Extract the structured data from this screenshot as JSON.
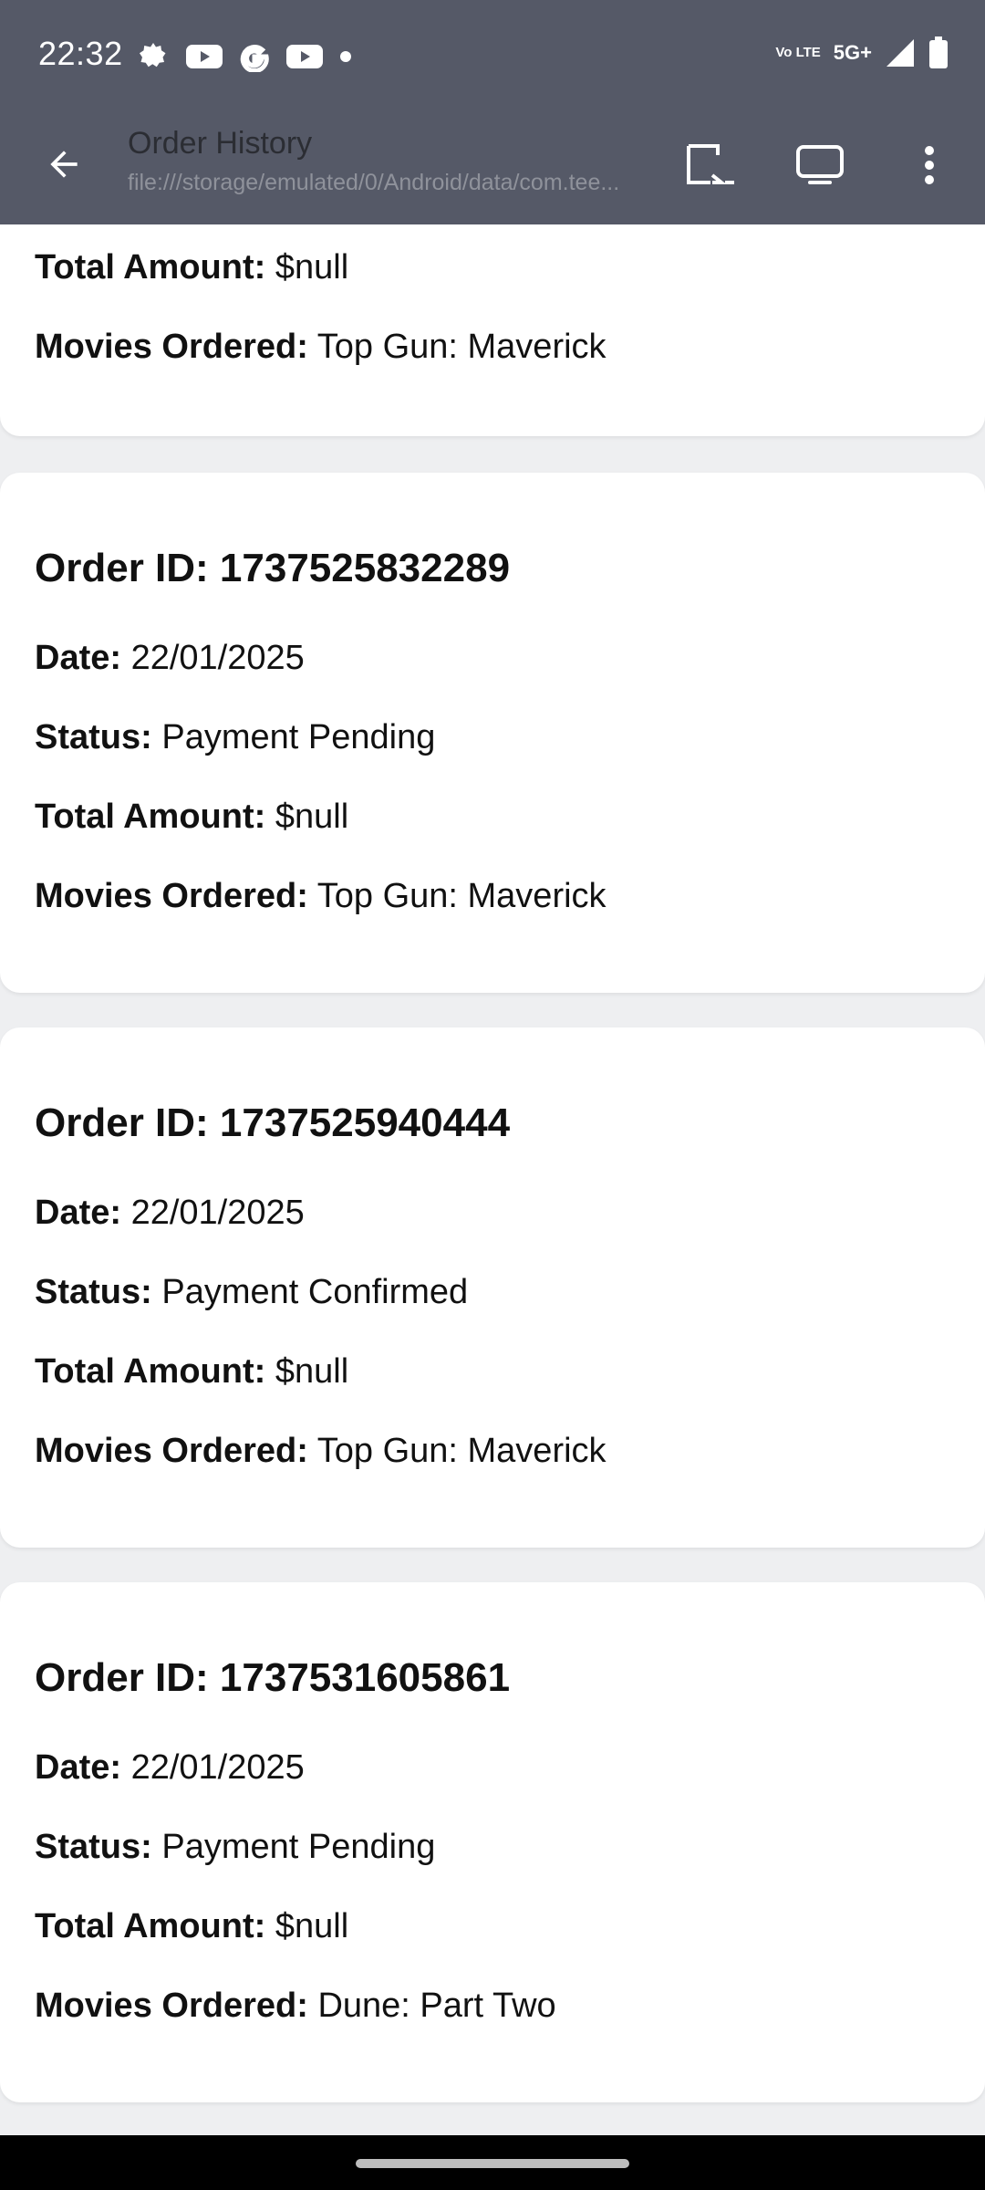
{
  "status_bar": {
    "time": "22:32",
    "left_icons": [
      "settings-icon",
      "youtube-icon",
      "google-icon",
      "youtube-icon",
      "dot-icon"
    ],
    "network": "5G+",
    "volte": "Vo LTE"
  },
  "toolbar": {
    "title": "Order History",
    "url": "file:///storage/emulated/0/Android/data/com.tee..."
  },
  "orders": [
    {
      "total_label": "Total Amount:",
      "total_value": "$null",
      "movies_label": "Movies Ordered:",
      "movies_value": "Top Gun: Maverick"
    },
    {
      "id_text": "Order ID: 1737525832289",
      "date_label": "Date:",
      "date_value": "22/01/2025",
      "status_label": "Status:",
      "status_value": "Payment Pending",
      "total_label": "Total Amount:",
      "total_value": "$null",
      "movies_label": "Movies Ordered:",
      "movies_value": "Top Gun: Maverick"
    },
    {
      "id_text": "Order ID: 1737525940444",
      "date_label": "Date:",
      "date_value": "22/01/2025",
      "status_label": "Status:",
      "status_value": "Payment Confirmed",
      "total_label": "Total Amount:",
      "total_value": "$null",
      "movies_label": "Movies Ordered:",
      "movies_value": "Top Gun: Maverick"
    },
    {
      "id_text": "Order ID: 1737531605861",
      "date_label": "Date:",
      "date_value": "22/01/2025",
      "status_label": "Status:",
      "status_value": "Payment Pending",
      "total_label": "Total Amount:",
      "total_value": "$null",
      "movies_label": "Movies Ordered:",
      "movies_value": "Dune: Part Two"
    }
  ],
  "colors": {
    "header_bg": "#555967",
    "page_bg": "#eeeff1",
    "card_bg": "#ffffff",
    "text": "#111111"
  }
}
